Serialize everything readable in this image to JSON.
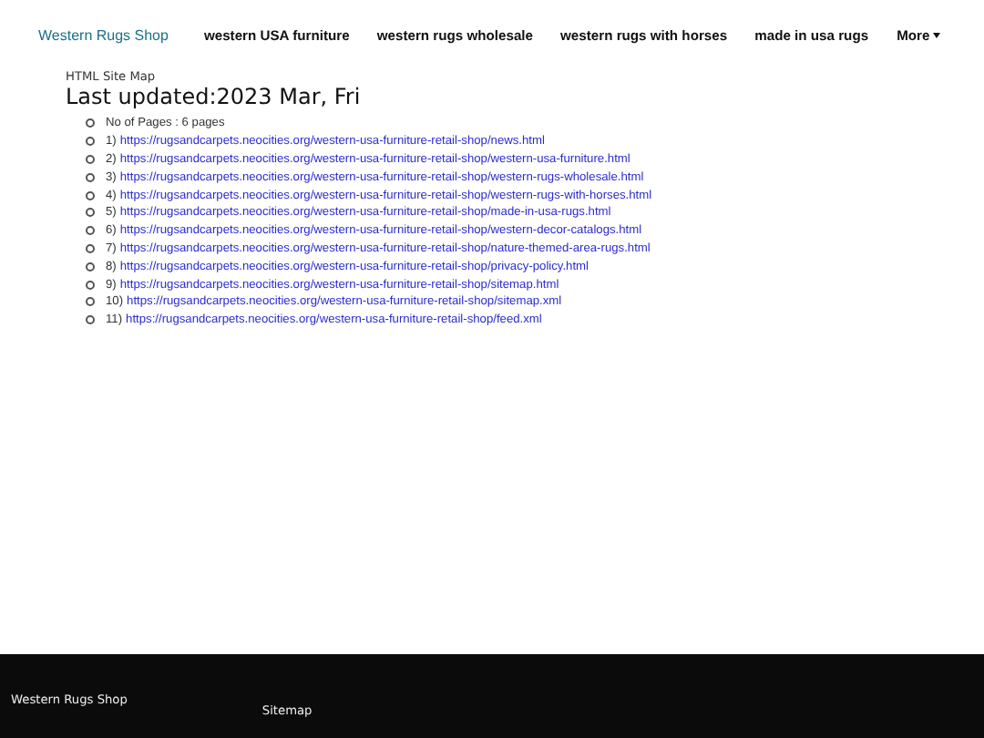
{
  "navbar": {
    "brand": "Western Rugs Shop",
    "links": [
      "western USA furniture",
      "western rugs wholesale",
      "western rugs with horses",
      "made in usa rugs"
    ],
    "more": {
      "label": "More",
      "caret": true
    }
  },
  "main": {
    "subtitle": "HTML Site Map",
    "title": "Last updated:2023 Mar, Fri",
    "count": "No of Pages : 6 pages",
    "pages": [
      {
        "number": "1)",
        "url": "https://rugsandcarpets.neocities.org/western-usa-furniture-retail-shop/news.html"
      },
      {
        "number": "2)",
        "url": "https://rugsandcarpets.neocities.org/western-usa-furniture-retail-shop/western-usa-furniture.html"
      },
      {
        "number": "3)",
        "url": "https://rugsandcarpets.neocities.org/western-usa-furniture-retail-shop/western-rugs-wholesale.html"
      },
      {
        "number": "4)",
        "url": "https://rugsandcarpets.neocities.org/western-usa-furniture-retail-shop/western-rugs-with-horses.html"
      },
      {
        "number": "5)",
        "url": "https://rugsandcarpets.neocities.org/western-usa-furniture-retail-shop/made-in-usa-rugs.html"
      },
      {
        "number": "6)",
        "url": "https://rugsandcarpets.neocities.org/western-usa-furniture-retail-shop/western-decor-catalogs.html"
      },
      {
        "number": "7)",
        "url": "https://rugsandcarpets.neocities.org/western-usa-furniture-retail-shop/nature-themed-area-rugs.html"
      },
      {
        "number": "8)",
        "url": "https://rugsandcarpets.neocities.org/western-usa-furniture-retail-shop/privacy-policy.html"
      },
      {
        "number": "9)",
        "url": "https://rugsandcarpets.neocities.org/western-usa-furniture-retail-shop/sitemap.html"
      },
      {
        "number": "10)",
        "url": "https://rugsandcarpets.neocities.org/western-usa-furniture-retail-shop/sitemap.xml"
      },
      {
        "number": "11)",
        "url": "https://rugsandcarpets.neocities.org/western-usa-furniture-retail-shop/feed.xml"
      }
    ]
  },
  "footer": {
    "brand": "Western Rugs Shop",
    "link": "Sitemap"
  }
}
